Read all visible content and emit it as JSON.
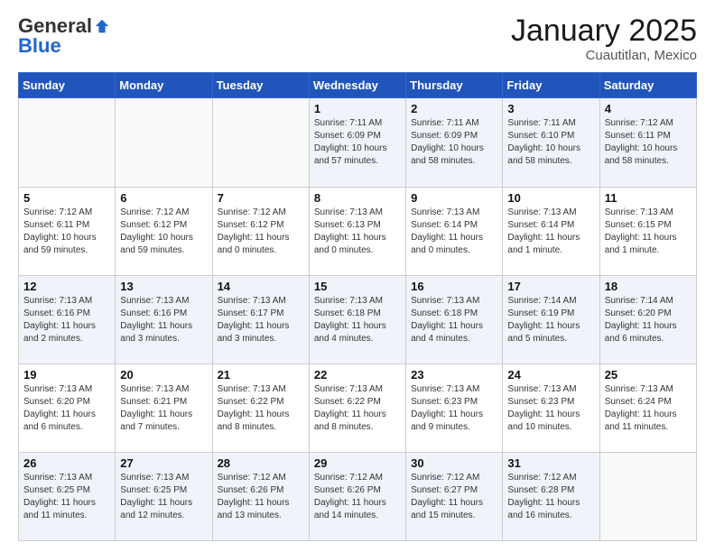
{
  "header": {
    "logo": {
      "general": "General",
      "blue": "Blue"
    },
    "title": "January 2025",
    "location": "Cuautitlan, Mexico"
  },
  "weekdays": [
    "Sunday",
    "Monday",
    "Tuesday",
    "Wednesday",
    "Thursday",
    "Friday",
    "Saturday"
  ],
  "weeks": [
    [
      {
        "day": "",
        "info": ""
      },
      {
        "day": "",
        "info": ""
      },
      {
        "day": "",
        "info": ""
      },
      {
        "day": "1",
        "info": "Sunrise: 7:11 AM\nSunset: 6:09 PM\nDaylight: 10 hours\nand 57 minutes."
      },
      {
        "day": "2",
        "info": "Sunrise: 7:11 AM\nSunset: 6:09 PM\nDaylight: 10 hours\nand 58 minutes."
      },
      {
        "day": "3",
        "info": "Sunrise: 7:11 AM\nSunset: 6:10 PM\nDaylight: 10 hours\nand 58 minutes."
      },
      {
        "day": "4",
        "info": "Sunrise: 7:12 AM\nSunset: 6:11 PM\nDaylight: 10 hours\nand 58 minutes."
      }
    ],
    [
      {
        "day": "5",
        "info": "Sunrise: 7:12 AM\nSunset: 6:11 PM\nDaylight: 10 hours\nand 59 minutes."
      },
      {
        "day": "6",
        "info": "Sunrise: 7:12 AM\nSunset: 6:12 PM\nDaylight: 10 hours\nand 59 minutes."
      },
      {
        "day": "7",
        "info": "Sunrise: 7:12 AM\nSunset: 6:12 PM\nDaylight: 11 hours\nand 0 minutes."
      },
      {
        "day": "8",
        "info": "Sunrise: 7:13 AM\nSunset: 6:13 PM\nDaylight: 11 hours\nand 0 minutes."
      },
      {
        "day": "9",
        "info": "Sunrise: 7:13 AM\nSunset: 6:14 PM\nDaylight: 11 hours\nand 0 minutes."
      },
      {
        "day": "10",
        "info": "Sunrise: 7:13 AM\nSunset: 6:14 PM\nDaylight: 11 hours\nand 1 minute."
      },
      {
        "day": "11",
        "info": "Sunrise: 7:13 AM\nSunset: 6:15 PM\nDaylight: 11 hours\nand 1 minute."
      }
    ],
    [
      {
        "day": "12",
        "info": "Sunrise: 7:13 AM\nSunset: 6:16 PM\nDaylight: 11 hours\nand 2 minutes."
      },
      {
        "day": "13",
        "info": "Sunrise: 7:13 AM\nSunset: 6:16 PM\nDaylight: 11 hours\nand 3 minutes."
      },
      {
        "day": "14",
        "info": "Sunrise: 7:13 AM\nSunset: 6:17 PM\nDaylight: 11 hours\nand 3 minutes."
      },
      {
        "day": "15",
        "info": "Sunrise: 7:13 AM\nSunset: 6:18 PM\nDaylight: 11 hours\nand 4 minutes."
      },
      {
        "day": "16",
        "info": "Sunrise: 7:13 AM\nSunset: 6:18 PM\nDaylight: 11 hours\nand 4 minutes."
      },
      {
        "day": "17",
        "info": "Sunrise: 7:14 AM\nSunset: 6:19 PM\nDaylight: 11 hours\nand 5 minutes."
      },
      {
        "day": "18",
        "info": "Sunrise: 7:14 AM\nSunset: 6:20 PM\nDaylight: 11 hours\nand 6 minutes."
      }
    ],
    [
      {
        "day": "19",
        "info": "Sunrise: 7:13 AM\nSunset: 6:20 PM\nDaylight: 11 hours\nand 6 minutes."
      },
      {
        "day": "20",
        "info": "Sunrise: 7:13 AM\nSunset: 6:21 PM\nDaylight: 11 hours\nand 7 minutes."
      },
      {
        "day": "21",
        "info": "Sunrise: 7:13 AM\nSunset: 6:22 PM\nDaylight: 11 hours\nand 8 minutes."
      },
      {
        "day": "22",
        "info": "Sunrise: 7:13 AM\nSunset: 6:22 PM\nDaylight: 11 hours\nand 8 minutes."
      },
      {
        "day": "23",
        "info": "Sunrise: 7:13 AM\nSunset: 6:23 PM\nDaylight: 11 hours\nand 9 minutes."
      },
      {
        "day": "24",
        "info": "Sunrise: 7:13 AM\nSunset: 6:23 PM\nDaylight: 11 hours\nand 10 minutes."
      },
      {
        "day": "25",
        "info": "Sunrise: 7:13 AM\nSunset: 6:24 PM\nDaylight: 11 hours\nand 11 minutes."
      }
    ],
    [
      {
        "day": "26",
        "info": "Sunrise: 7:13 AM\nSunset: 6:25 PM\nDaylight: 11 hours\nand 11 minutes."
      },
      {
        "day": "27",
        "info": "Sunrise: 7:13 AM\nSunset: 6:25 PM\nDaylight: 11 hours\nand 12 minutes."
      },
      {
        "day": "28",
        "info": "Sunrise: 7:12 AM\nSunset: 6:26 PM\nDaylight: 11 hours\nand 13 minutes."
      },
      {
        "day": "29",
        "info": "Sunrise: 7:12 AM\nSunset: 6:26 PM\nDaylight: 11 hours\nand 14 minutes."
      },
      {
        "day": "30",
        "info": "Sunrise: 7:12 AM\nSunset: 6:27 PM\nDaylight: 11 hours\nand 15 minutes."
      },
      {
        "day": "31",
        "info": "Sunrise: 7:12 AM\nSunset: 6:28 PM\nDaylight: 11 hours\nand 16 minutes."
      },
      {
        "day": "",
        "info": ""
      }
    ]
  ]
}
